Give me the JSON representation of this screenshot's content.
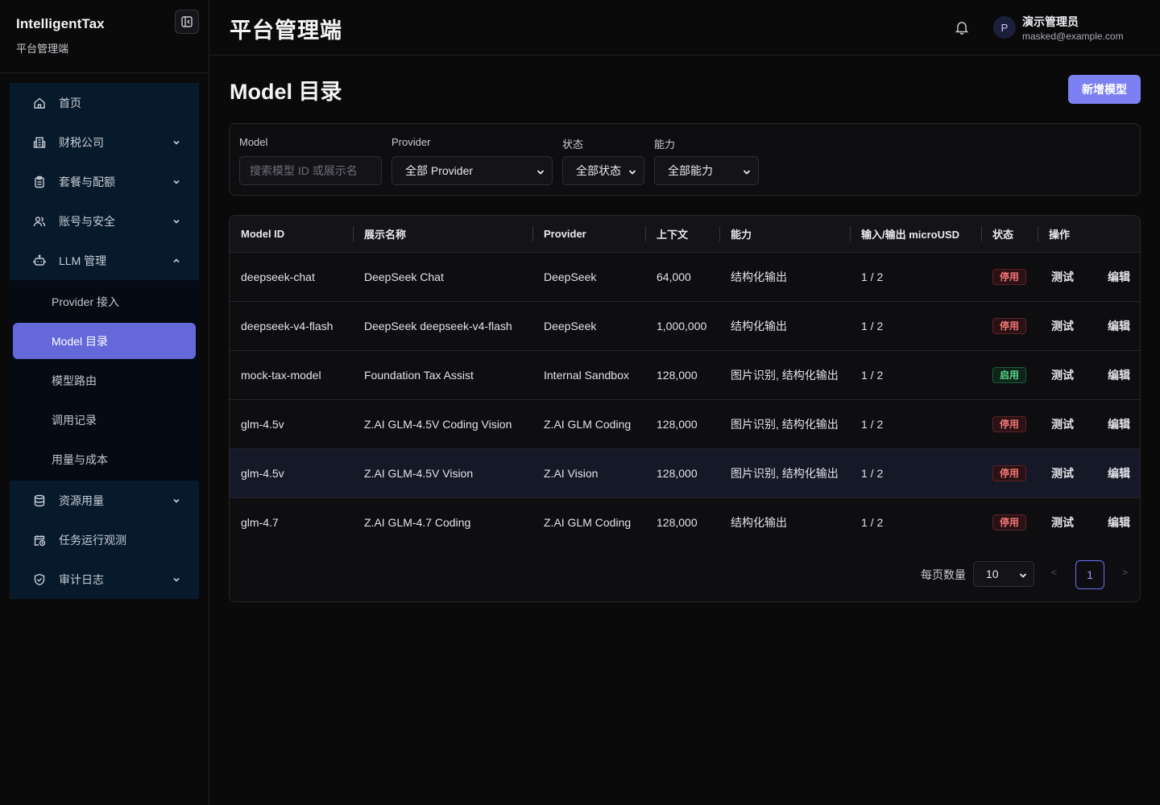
{
  "brand": {
    "title": "IntelligentTax",
    "subtitle": "平台管理端"
  },
  "sidebar": {
    "items": [
      {
        "label": "首页",
        "icon": "home-icon"
      },
      {
        "label": "财税公司",
        "icon": "building-icon",
        "expandable": true
      },
      {
        "label": "套餐与配额",
        "icon": "clipboard-icon",
        "expandable": true
      },
      {
        "label": "账号与安全",
        "icon": "users-icon",
        "expandable": true
      },
      {
        "label": "LLM 管理",
        "icon": "bot-icon",
        "expanded": true
      }
    ],
    "llm_children": [
      "Provider 接入",
      "Model 目录",
      "模型路由",
      "调用记录",
      "用量与成本"
    ],
    "active_child": "Model 目录",
    "items_after": [
      {
        "label": "资源用量",
        "icon": "database-icon",
        "expandable": true
      },
      {
        "label": "任务运行观测",
        "icon": "calendar-clock-icon"
      },
      {
        "label": "审计日志",
        "icon": "shield-check-icon",
        "expandable": true
      }
    ]
  },
  "header": {
    "title": "平台管理端",
    "user": {
      "initial": "P",
      "name": "演示管理员",
      "email": "masked@example.com"
    }
  },
  "page": {
    "title": "Model 目录",
    "add_button": "新增模型"
  },
  "filters": {
    "model_label": "Model",
    "model_placeholder": "搜索模型 ID 或展示名",
    "provider_label": "Provider",
    "provider_value": "全部 Provider",
    "status_label": "状态",
    "status_value": "全部状态",
    "capability_label": "能力",
    "capability_value": "全部能力"
  },
  "table": {
    "columns": [
      "Model ID",
      "展示名称",
      "Provider",
      "上下文",
      "能力",
      "输入/输出 microUSD",
      "状态",
      "操作"
    ],
    "rows": [
      {
        "id": "deepseek-chat",
        "name": "DeepSeek Chat",
        "provider": "DeepSeek",
        "context": "64,000",
        "capability": "结构化输出",
        "io": "1 / 2",
        "status": "停用",
        "active": false
      },
      {
        "id": "deepseek-v4-flash",
        "name": "DeepSeek deepseek-v4-flash",
        "provider": "DeepSeek",
        "context": "1,000,000",
        "capability": "结构化输出",
        "io": "1 / 2",
        "status": "停用",
        "active": false
      },
      {
        "id": "mock-tax-model",
        "name": "Foundation Tax Assist",
        "provider": "Internal Sandbox",
        "context": "128,000",
        "capability": "图片识别, 结构化输出",
        "io": "1 / 2",
        "status": "启用",
        "active": true
      },
      {
        "id": "glm-4.5v",
        "name": "Z.AI GLM-4.5V Coding Vision",
        "provider": "Z.AI GLM Coding",
        "context": "128,000",
        "capability": "图片识别, 结构化输出",
        "io": "1 / 2",
        "status": "停用",
        "active": false
      },
      {
        "id": "glm-4.5v",
        "name": "Z.AI GLM-4.5V Vision",
        "provider": "Z.AI Vision",
        "context": "128,000",
        "capability": "图片识别, 结构化输出",
        "io": "1 / 2",
        "status": "停用",
        "active": false,
        "highlighted": true
      },
      {
        "id": "glm-4.7",
        "name": "Z.AI GLM-4.7 Coding",
        "provider": "Z.AI GLM Coding",
        "context": "128,000",
        "capability": "结构化输出",
        "io": "1 / 2",
        "status": "停用",
        "active": false
      }
    ],
    "actions": {
      "test": "测试",
      "edit": "编辑"
    }
  },
  "pagination": {
    "page_size_label": "每页数量",
    "page_size": "10",
    "current_page": "1",
    "prev": "<",
    "next": ">"
  },
  "colors": {
    "accent": "#7c80f2",
    "active_nav": "#6468d8",
    "badge_off": "#f07575",
    "badge_on": "#57d38c"
  }
}
